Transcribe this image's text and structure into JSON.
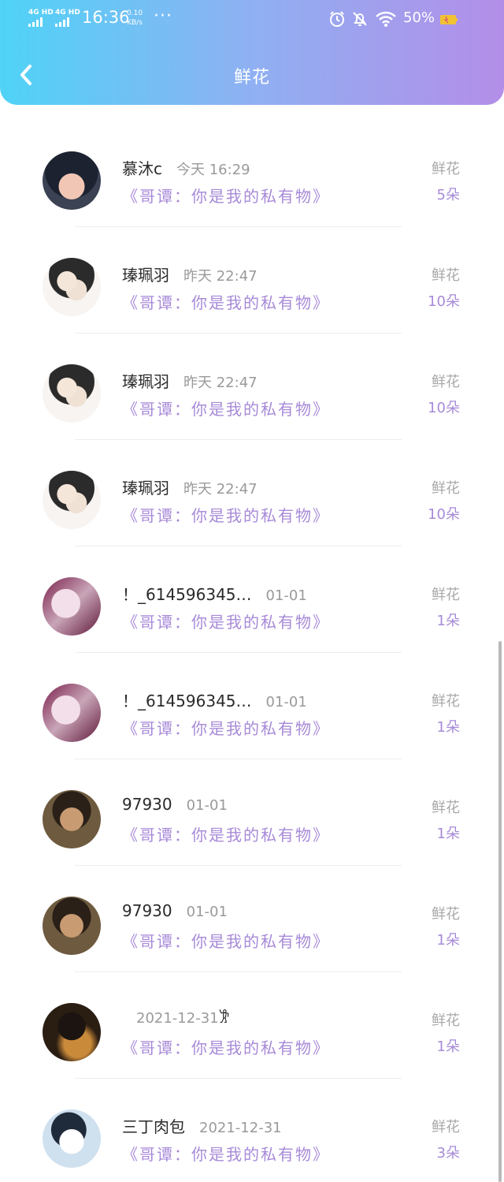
{
  "status_bar": {
    "network_1": "4G HD",
    "network_2": "4G HD",
    "time": "16:36",
    "speed_value": "0.10",
    "speed_unit": "KB/s",
    "more": "···",
    "battery": "50%"
  },
  "nav": {
    "title": "鲜花"
  },
  "items": [
    {
      "name": "慕沐c",
      "time": "今天 16:29",
      "book": "《哥谭：你是我的私有物》",
      "gift": "鲜花",
      "count": "5朵",
      "avatar": "avatar-1"
    },
    {
      "name": "瑧珮羽",
      "time": "昨天 22:47",
      "book": "《哥谭：你是我的私有物》",
      "gift": "鲜花",
      "count": "10朵",
      "avatar": "avatar-2"
    },
    {
      "name": "瑧珮羽",
      "time": "昨天 22:47",
      "book": "《哥谭：你是我的私有物》",
      "gift": "鲜花",
      "count": "10朵",
      "avatar": "avatar-2"
    },
    {
      "name": "瑧珮羽",
      "time": "昨天 22:47",
      "book": "《哥谭：你是我的私有物》",
      "gift": "鲜花",
      "count": "10朵",
      "avatar": "avatar-2"
    },
    {
      "name": "！_614596345…",
      "time": "01-01",
      "book": "《哥谭：你是我的私有物》",
      "gift": "鲜花",
      "count": "1朵",
      "avatar": "avatar-3"
    },
    {
      "name": "！_614596345…",
      "time": "01-01",
      "book": "《哥谭：你是我的私有物》",
      "gift": "鲜花",
      "count": "1朵",
      "avatar": "avatar-3"
    },
    {
      "name": "97930",
      "time": "01-01",
      "book": "《哥谭：你是我的私有物》",
      "gift": "鲜花",
      "count": "1朵",
      "avatar": "avatar-4"
    },
    {
      "name": "97930",
      "time": "01-01",
      "book": "《哥谭：你是我的私有物》",
      "gift": "鲜花",
      "count": "1朵",
      "avatar": "avatar-4"
    },
    {
      "name": "𐦂",
      "time": "2021-12-31",
      "book": "《哥谭：你是我的私有物》",
      "gift": "鲜花",
      "count": "1朵",
      "avatar": "avatar-5"
    },
    {
      "name": "三丁肉包",
      "time": "2021-12-31",
      "book": "《哥谭：你是我的私有物》",
      "gift": "鲜花",
      "count": "3朵",
      "avatar": "avatar-6"
    }
  ]
}
